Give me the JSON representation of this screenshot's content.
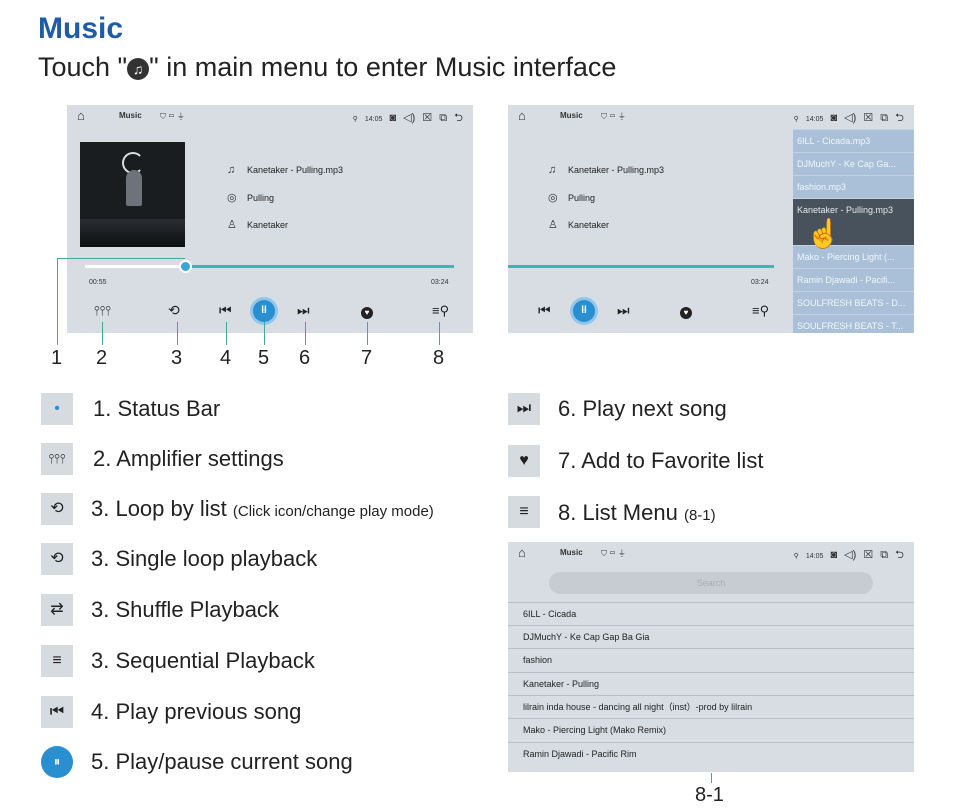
{
  "header": {
    "title": "Music",
    "subtitle_before": "Touch \"",
    "subtitle_icon": "♫",
    "subtitle_after": "\" in main menu to enter Music interface"
  },
  "statusbar": {
    "title": "Music",
    "mini_icons": "⛉ ▭ ⏚",
    "gps_icon": "⚲",
    "time": "14:05",
    "right_icons": "◙ ◁) ☒ ⧉ ⮌",
    "home_icon": "⌂"
  },
  "screen1": {
    "song_file": "Kanetaker - Pulling.mp3",
    "album": "Pulling",
    "artist": "Kanetaker",
    "elapsed": "00:55",
    "total": "03:24",
    "progress_fraction": 0.27
  },
  "screen2": {
    "song_file": "Kanetaker - Pulling.mp3",
    "album": "Pulling",
    "artist": "Kanetaker",
    "total": "03:24",
    "playlist": [
      "6ILL - Cicada.mp3",
      "DJMuchY - Ke Cap Ga...",
      "fashion.mp3",
      "Kanetaker - Pulling.mp3",
      "Mako - Piercing Light (...",
      "Ramin Djawadi - Pacifi...",
      "SOULFRESH BEATS - D...",
      "SOULFRESH BEATS - T..."
    ]
  },
  "callouts": [
    "1",
    "2",
    "3",
    "4",
    "5",
    "6",
    "7",
    "8"
  ],
  "legend": [
    {
      "icon": "•",
      "text": "1. Status Bar",
      "note": ""
    },
    {
      "icon": "⫯⫯⫯",
      "text": "2. Amplifier settings",
      "note": ""
    },
    {
      "icon": "⟲",
      "text": "3. Loop by list",
      "note": "(Click icon/change play mode)"
    },
    {
      "icon": "⟲",
      "text": "3. Single loop playback",
      "note": ""
    },
    {
      "icon": "⇄",
      "text": "3. Shuffle Playback",
      "note": ""
    },
    {
      "icon": "≡",
      "text": "3. Sequential Playback",
      "note": ""
    },
    {
      "icon": "⏮",
      "text": "4. Play previous song",
      "note": ""
    },
    {
      "icon": "⏸",
      "text": "5. Play/pause current song",
      "note": ""
    },
    {
      "icon": "⏭",
      "text": "6. Play next song",
      "note": ""
    },
    {
      "icon": "♥",
      "text": "7. Add to Favorite list",
      "note": ""
    },
    {
      "icon": "≡",
      "text": "8. List Menu",
      "note": "(8-1)"
    }
  ],
  "list_menu": {
    "search_placeholder": "Search",
    "items": [
      "6ILL - Cicada",
      "DJMuchY - Ke Cap Gap Ba Gia",
      "fashion",
      "Kanetaker - Pulling",
      "lilrain inda house - dancing all night（inst）-prod by lilrain",
      "Mako - Piercing Light (Mako Remix)",
      "Ramin Djawadi - Pacific Rim"
    ],
    "label": "8-1"
  }
}
